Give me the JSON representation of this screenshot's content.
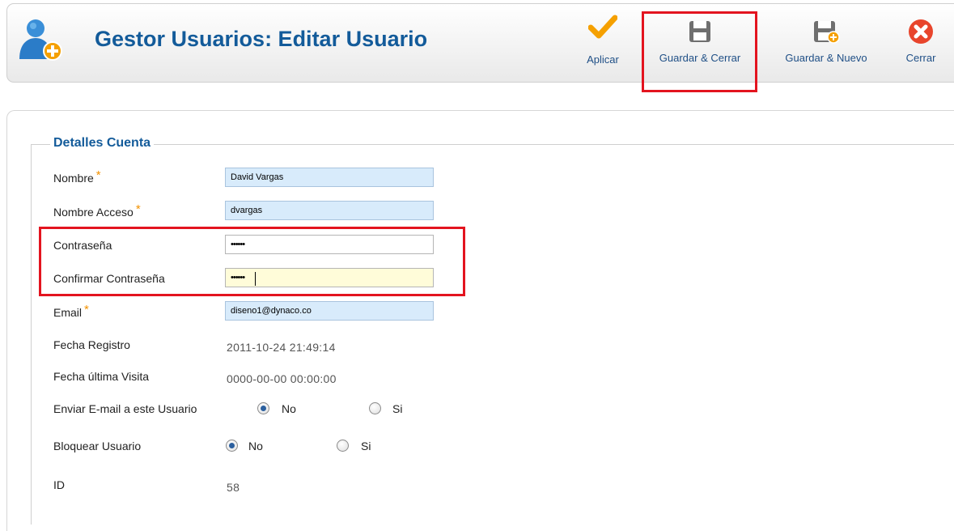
{
  "header": {
    "title": "Gestor Usuarios: Editar Usuario",
    "icon": "user-add-icon"
  },
  "toolbar": {
    "buttons": [
      {
        "label": "Aplicar",
        "icon": "checkmark-icon",
        "color": "#f5a000"
      },
      {
        "label": "Guardar & Cerrar",
        "icon": "save-icon",
        "highlighted": true
      },
      {
        "label": "Guardar & Nuevo",
        "icon": "save-new-icon"
      },
      {
        "label": "Cerrar",
        "icon": "close-icon",
        "color": "#e8452c"
      }
    ]
  },
  "form": {
    "legend": "Detalles Cuenta",
    "required_mark": "*",
    "fields": {
      "nombre": {
        "label": "Nombre",
        "value": "David Vargas"
      },
      "nombre_acceso": {
        "label": "Nombre Acceso",
        "value": "dvargas"
      },
      "contrasena": {
        "label": "Contraseña",
        "value": "••••••"
      },
      "confirmar": {
        "label": "Confirmar Contraseña",
        "value": "••••••"
      },
      "email": {
        "label": "Email",
        "value": "diseno1@dynaco.co"
      },
      "fecha_registro": {
        "label": "Fecha Registro",
        "value": "2011-10-24 21:49:14"
      },
      "fecha_visita": {
        "label": "Fecha última Visita",
        "value": "0000-00-00 00:00:00"
      },
      "enviar_email": {
        "label": "Enviar E-mail a este Usuario",
        "options": [
          "No",
          "Si"
        ],
        "selected": "No"
      },
      "bloquear": {
        "label": "Bloquear Usuario",
        "options": [
          "No",
          "Si"
        ],
        "selected": "No"
      },
      "id": {
        "label": "ID",
        "value": "58"
      }
    }
  },
  "colors": {
    "title": "#135b9a",
    "highlight": "#e3141f",
    "required": "#f39200",
    "input_bg": "#d8ebfb",
    "focus_bg": "#fffcd9"
  }
}
